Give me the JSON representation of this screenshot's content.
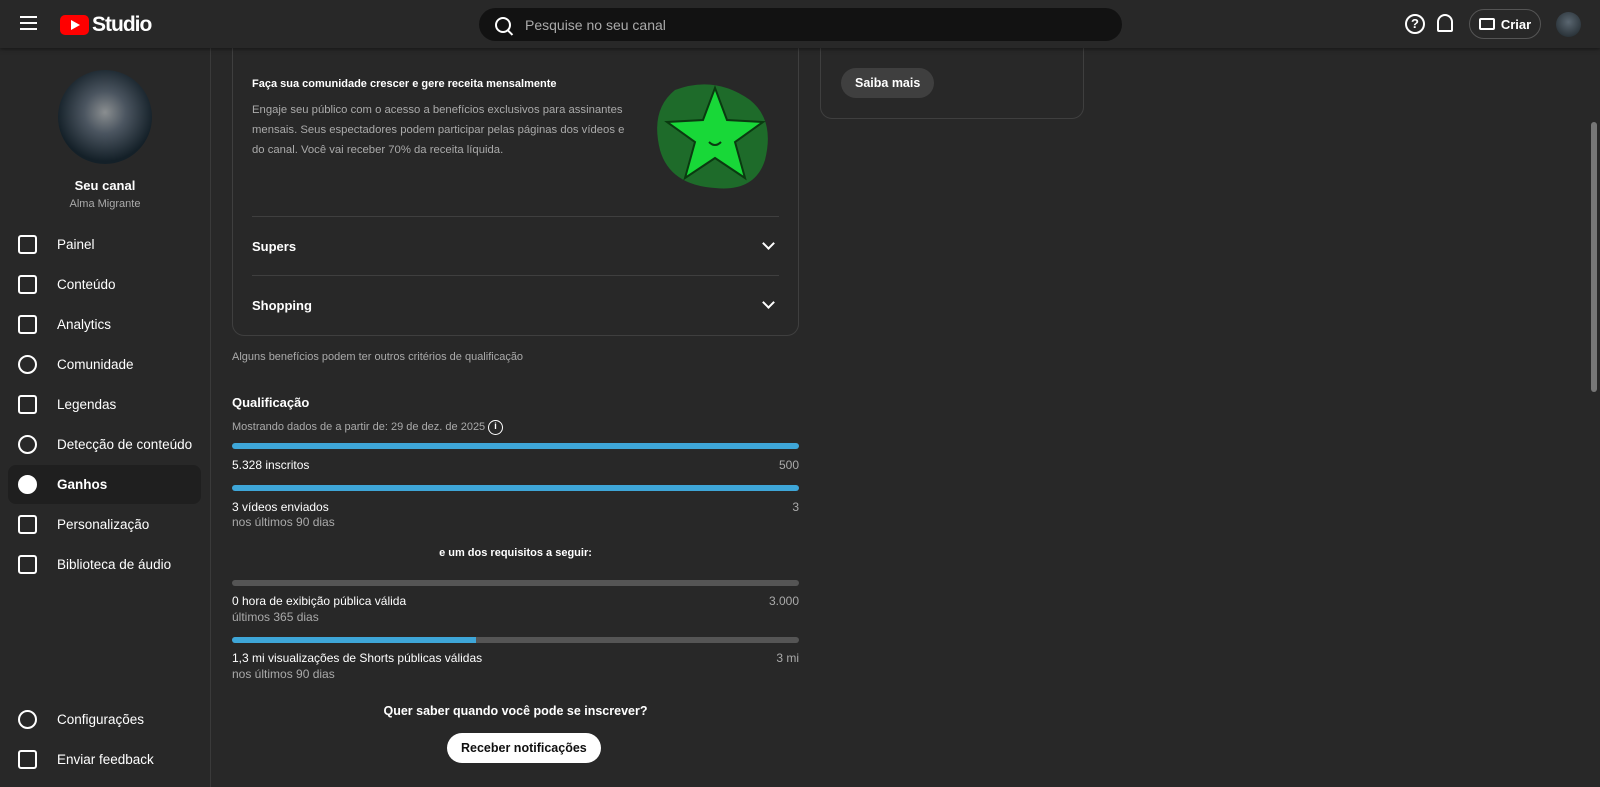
{
  "header": {
    "logo": "Studio",
    "search_placeholder": "Pesquise no seu canal",
    "help": "?",
    "create_label": "Criar"
  },
  "sidebar": {
    "channel_title": "Seu canal",
    "channel_name": "Alma Migrante",
    "items": [
      {
        "label": "Painel"
      },
      {
        "label": "Conteúdo"
      },
      {
        "label": "Analytics"
      },
      {
        "label": "Comunidade"
      },
      {
        "label": "Legendas"
      },
      {
        "label": "Detecção de conteúdo"
      },
      {
        "label": "Ganhos",
        "active": true
      },
      {
        "label": "Personalização"
      },
      {
        "label": "Biblioteca de áudio"
      }
    ],
    "bottom": [
      {
        "label": "Configurações"
      },
      {
        "label": "Enviar feedback"
      }
    ]
  },
  "memberships": {
    "title": "Faça sua comunidade crescer e gere receita mensalmente",
    "desc": "Engaje seu público com o acesso a benefícios exclusivos para assinantes mensais. Seus espectadores podem participar pelas páginas dos vídeos e do canal. Você vai receber 70% da receita líquida."
  },
  "accordions": [
    {
      "label": "Supers"
    },
    {
      "label": "Shopping"
    }
  ],
  "note": "Alguns benefícios podem ter outros critérios de qualificação",
  "side_card": {
    "button": "Saiba mais"
  },
  "qualification": {
    "title": "Qualificação",
    "date_note": "Mostrando dados de a partir de: 29 de dez. de 2025",
    "requirements": [
      {
        "label": "5.328 inscritos",
        "target": "500",
        "progress": 1.0
      },
      {
        "label": "3 vídeos enviados",
        "target": "3",
        "sub": "nos últimos 90 dias",
        "progress": 1.0
      }
    ],
    "or_label": "e um dos requisitos a seguir:",
    "alternatives": [
      {
        "label": "0 hora de exibição pública válida",
        "target": "3.000",
        "sub": "últimos 365 dias",
        "progress": 0
      },
      {
        "label": "1,3 mi visualizações de Shorts públicas válidas",
        "target": "3 mi",
        "sub": "nos últimos 90 dias",
        "progress": 0.43
      }
    ],
    "question": "Quer saber quando você pode se inscrever?",
    "notify_button": "Receber notificações"
  },
  "colors": {
    "accent": "#3ea6d8",
    "bg": "#282828"
  }
}
